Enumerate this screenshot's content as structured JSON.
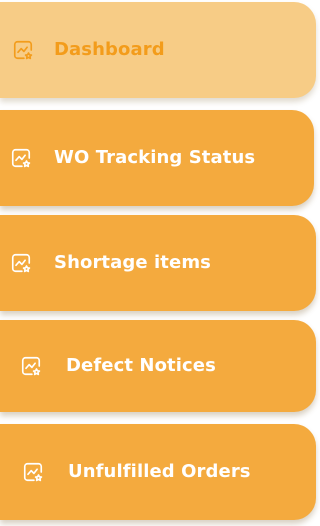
{
  "nav": {
    "items": [
      {
        "label": "Dashboard",
        "icon": "chart-star-icon",
        "active": true
      },
      {
        "label": "WO Tracking Status",
        "icon": "chart-star-icon",
        "active": false
      },
      {
        "label": "Shortage items",
        "icon": "chart-star-icon",
        "active": false
      },
      {
        "label": "Defect Notices",
        "icon": "chart-star-icon",
        "active": false
      },
      {
        "label": "Unfulfilled Orders",
        "icon": "chart-star-icon",
        "active": false
      }
    ]
  },
  "colors": {
    "item_background": "#f4aa3e",
    "active_background": "#f7cc86",
    "active_text": "#f39c1b",
    "text": "#ffffff"
  }
}
